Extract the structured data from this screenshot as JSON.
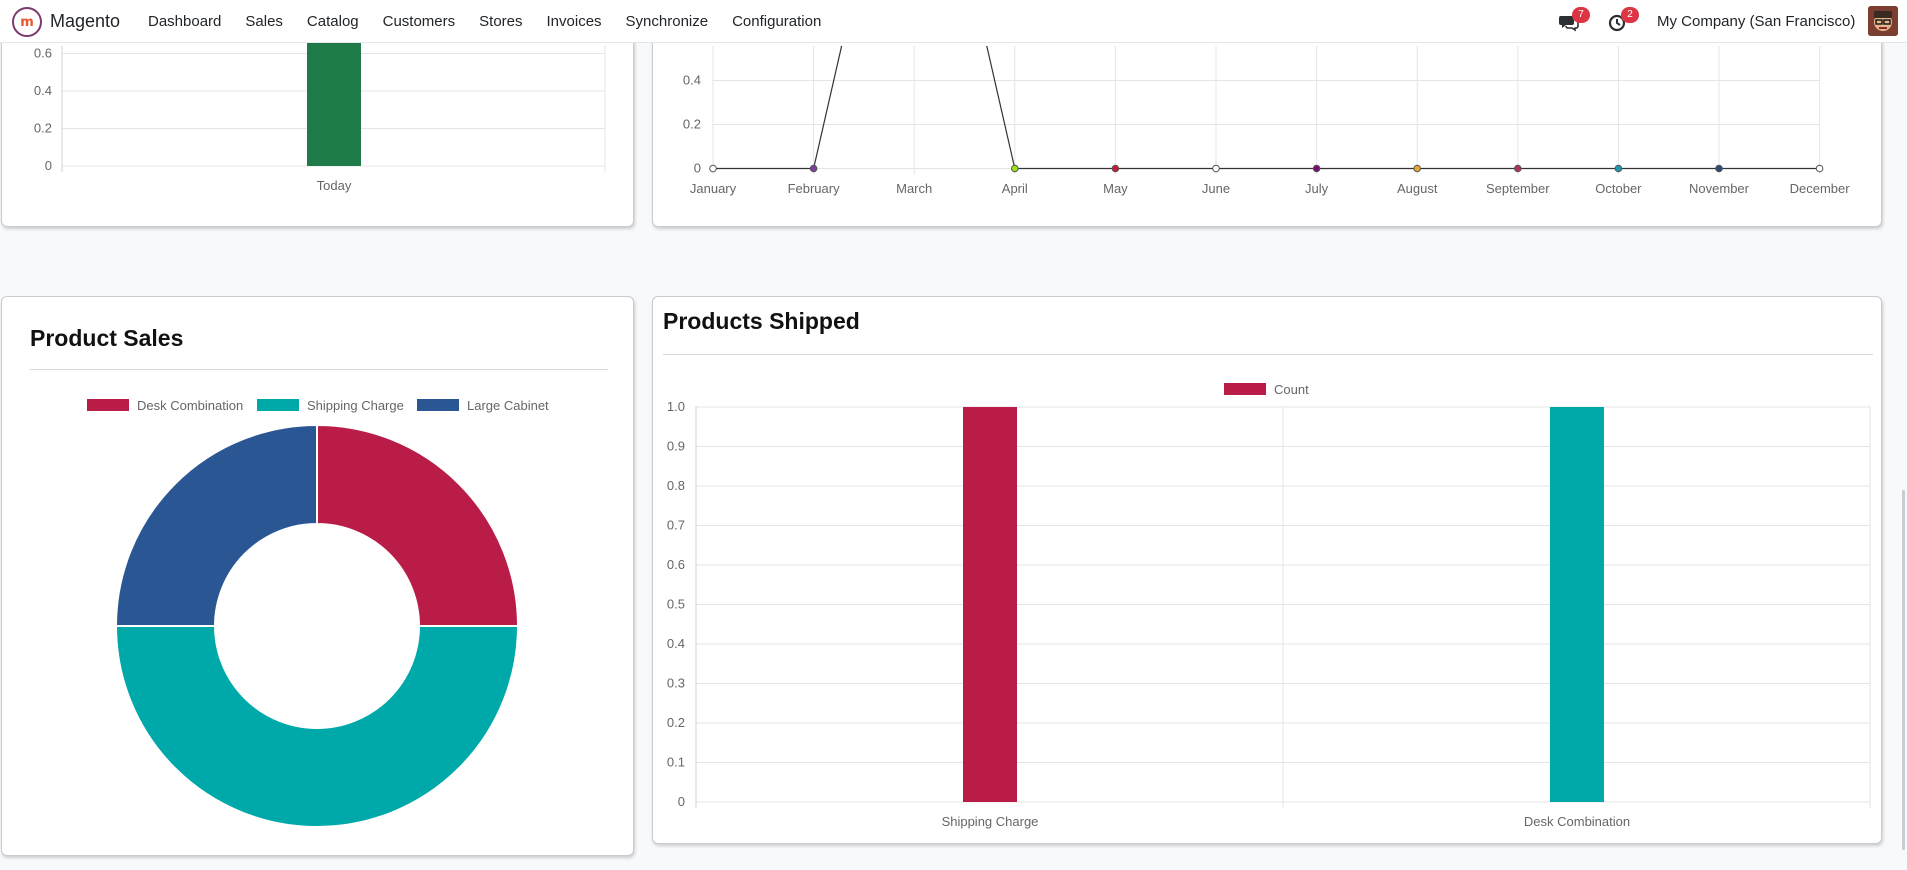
{
  "app": {
    "name": "Magento",
    "menu": [
      "Dashboard",
      "Sales",
      "Catalog",
      "Customers",
      "Stores",
      "Invoices",
      "Synchronize",
      "Configuration"
    ]
  },
  "systray": {
    "messages_count": "7",
    "activities_count": "2",
    "company": "My Company (San Francisco)"
  },
  "colors": {
    "crimson": "#b91c47",
    "teal": "#00a9a9",
    "navy": "#2b5694",
    "green": "#1f7a4a"
  },
  "icons": [
    "messages-icon",
    "activity-clock-icon",
    "magento-logo-icon",
    "avatar"
  ],
  "chart_data": [
    {
      "type": "bar",
      "categories": [
        "Today"
      ],
      "values": [
        1
      ],
      "yticks": [
        "0",
        "0.2",
        "0.4",
        "0.6"
      ],
      "ylim": [
        0,
        1
      ],
      "colors": [
        "#1f7a4a"
      ]
    },
    {
      "type": "line",
      "categories": [
        "January",
        "February",
        "March",
        "April",
        "May",
        "June",
        "July",
        "August",
        "September",
        "October",
        "November",
        "December"
      ],
      "values": [
        null,
        0,
        2,
        0,
        0,
        0,
        0,
        0,
        0,
        0,
        0,
        0
      ],
      "yticks": [
        "0",
        "0.2",
        "0.4"
      ],
      "point_colors": [
        "#ffffff",
        "#7b3fa0",
        null,
        "#9be21a",
        "#c8193c",
        "#ffffff",
        "#7a0d6b",
        "#e8a62a",
        "#b03060",
        "#1f9aaa",
        "#2e4a7a",
        "#ffffff"
      ]
    },
    {
      "type": "pie",
      "title": "Product Sales",
      "labels": [
        "Desk Combination",
        "Shipping Charge",
        "Large Cabinet"
      ],
      "values": [
        1,
        2,
        1
      ],
      "colors": [
        "#b91c47",
        "#00a9a9",
        "#2b5694"
      ]
    },
    {
      "type": "bar",
      "title": "Products Shipped",
      "legend": [
        "Count"
      ],
      "categories": [
        "Shipping Charge",
        "Desk Combination"
      ],
      "values": [
        1.0,
        1.0
      ],
      "colors": [
        "#b91c47",
        "#00a9a9"
      ],
      "yticks": [
        "0",
        "0.1",
        "0.2",
        "0.3",
        "0.4",
        "0.5",
        "0.6",
        "0.7",
        "0.8",
        "0.9",
        "1.0"
      ],
      "ylim": [
        0,
        1
      ]
    }
  ]
}
